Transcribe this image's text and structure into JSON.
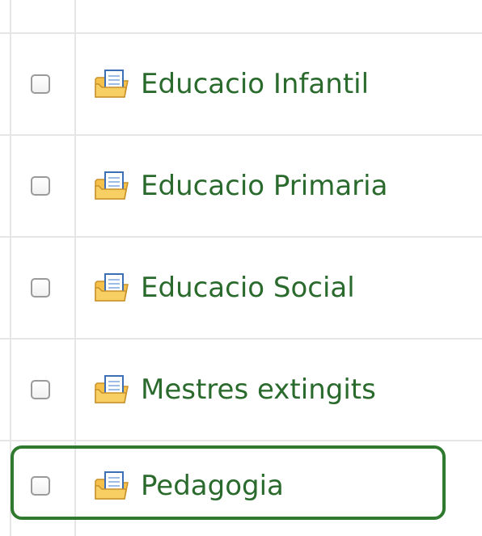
{
  "file_list": {
    "items": [
      {
        "name": "Educacio Infantil",
        "icon": "folder-document-icon",
        "checked": false
      },
      {
        "name": "Educacio Primaria",
        "icon": "folder-document-icon",
        "checked": false
      },
      {
        "name": "Educacio Social",
        "icon": "folder-document-icon",
        "checked": false
      },
      {
        "name": "Mestres extingits",
        "icon": "folder-document-icon",
        "checked": false
      },
      {
        "name": "Pedagogia",
        "icon": "folder-document-icon",
        "checked": false
      }
    ],
    "highlighted_item": "Pedagogia"
  },
  "colors": {
    "link": "#2a6a2c",
    "highlight": "#2f7a2f",
    "grid": "#e6e6e6",
    "checkbox_border": "#9a9a9a"
  }
}
